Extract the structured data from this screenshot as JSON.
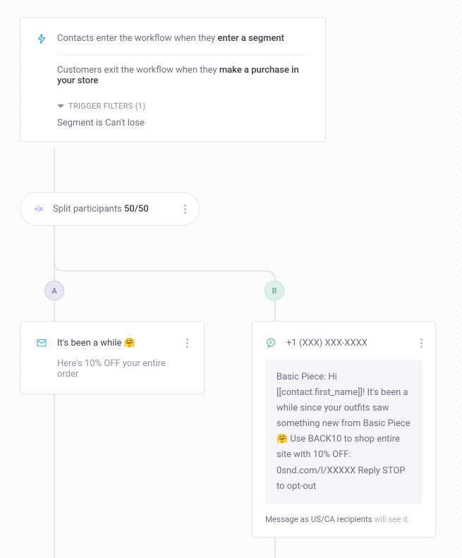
{
  "trigger": {
    "enter_prefix": "Contacts enter the workflow when they ",
    "enter_bold": "enter a segment",
    "exit_prefix": "Customers exit the workflow when they ",
    "exit_bold": "make a purchase in your store",
    "filters_label": "TRIGGER FILTERS (1)",
    "filter_text": "Segment is Can't lose"
  },
  "split": {
    "label_prefix": "Split participants ",
    "label_bold": "50/50"
  },
  "branches": {
    "a": "A",
    "b": "B"
  },
  "email": {
    "subject": "It's been a while 🤗",
    "preview": "Here's 10% OFF your entire order"
  },
  "sms": {
    "from": "+1 (XXX) XXX-XXXX",
    "body": "Basic Piece: Hi [[contact.first_name]]! It's been a while since your outfits saw something new from Basic Piece 🤗 Use BACK10 to shop entire site with 10% OFF: 0snd.com/l/XXXXX Reply STOP to opt-out",
    "footer_dark": "Message as US/CA recipients ",
    "footer_light": "will see it"
  }
}
